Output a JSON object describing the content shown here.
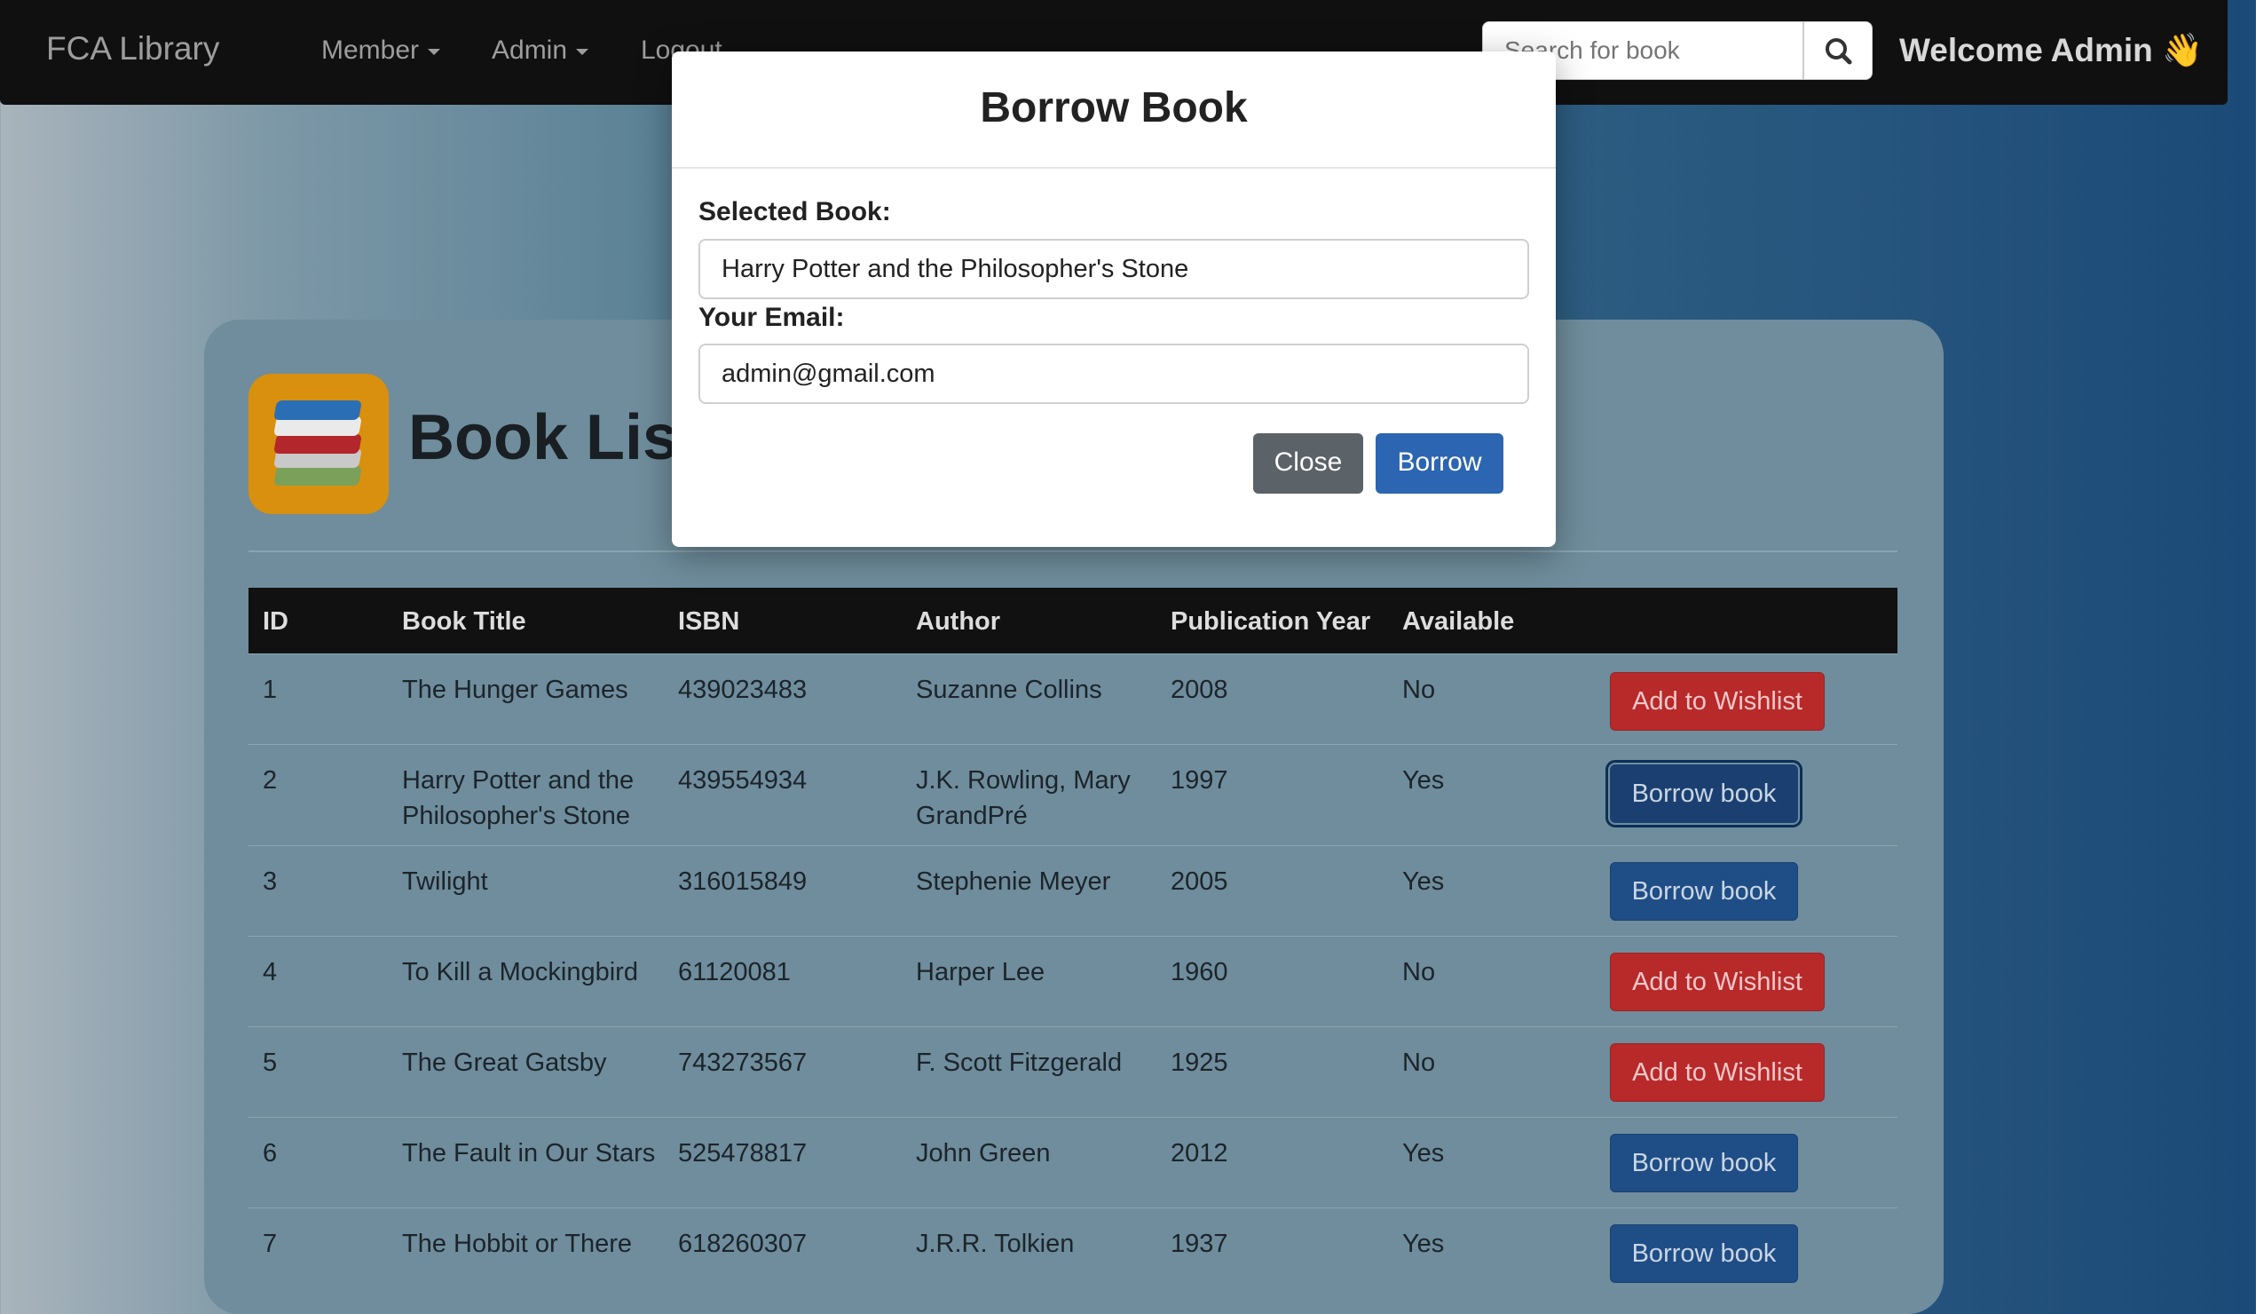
{
  "navbar": {
    "brand": "FCA Library",
    "menu": [
      {
        "label": "Member",
        "dropdown": true
      },
      {
        "label": "Admin",
        "dropdown": true
      },
      {
        "label": "Logout",
        "dropdown": false
      }
    ],
    "search_placeholder": "Search for book",
    "welcome": "Welcome Admin",
    "welcome_emoji": "👋"
  },
  "page": {
    "title": "Book List"
  },
  "table": {
    "headers": [
      "ID",
      "Book Title",
      "ISBN",
      "Author",
      "Publication Year",
      "Available"
    ],
    "rows": [
      {
        "id": "1",
        "title": "The Hunger Games",
        "isbn": "439023483",
        "author": "Suzanne Collins",
        "year": "2008",
        "available": "No",
        "action": "Add to Wishlist",
        "action_type": "wishlist"
      },
      {
        "id": "2",
        "title": "Harry Potter and the Philosopher's Stone",
        "isbn": "439554934",
        "author": "J.K. Rowling, Mary GrandPré",
        "year": "1997",
        "available": "Yes",
        "action": "Borrow book",
        "action_type": "borrow"
      },
      {
        "id": "3",
        "title": "Twilight",
        "isbn": "316015849",
        "author": "Stephenie Meyer",
        "year": "2005",
        "available": "Yes",
        "action": "Borrow book",
        "action_type": "borrow"
      },
      {
        "id": "4",
        "title": "To Kill a Mockingbird",
        "isbn": "61120081",
        "author": "Harper Lee",
        "year": "1960",
        "available": "No",
        "action": "Add to Wishlist",
        "action_type": "wishlist"
      },
      {
        "id": "5",
        "title": "The Great Gatsby",
        "isbn": "743273567",
        "author": "F. Scott Fitzgerald",
        "year": "1925",
        "available": "No",
        "action": "Add to Wishlist",
        "action_type": "wishlist"
      },
      {
        "id": "6",
        "title": "The Fault in Our Stars",
        "isbn": "525478817",
        "author": "John Green",
        "year": "2012",
        "available": "Yes",
        "action": "Borrow book",
        "action_type": "borrow"
      },
      {
        "id": "7",
        "title": "The Hobbit or There",
        "isbn": "618260307",
        "author": "J.R.R. Tolkien",
        "year": "1937",
        "available": "Yes",
        "action": "Borrow book",
        "action_type": "borrow"
      }
    ]
  },
  "modal": {
    "title": "Borrow Book",
    "selected_book_label": "Selected Book:",
    "selected_book_value": "Harry Potter and the Philosopher's Stone",
    "email_label": "Your Email:",
    "email_value": "admin@gmail.com",
    "close_label": "Close",
    "borrow_label": "Borrow"
  },
  "colors": {
    "navbar": "#101010",
    "wishlist_button": "#b8292a",
    "borrow_button": "#1f4d86",
    "modal_borrow_button": "#2c65b1",
    "modal_close_button": "#5b6268"
  }
}
